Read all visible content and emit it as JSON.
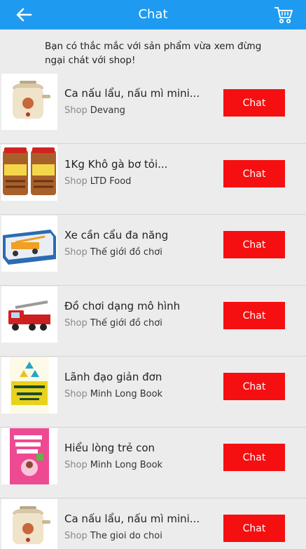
{
  "header": {
    "title": "Chat",
    "back_icon": "arrow-left-icon",
    "cart_icon": "shopping-cart-icon",
    "bg_color": "#1e9bf0"
  },
  "notice": "Bạn có thắc mắc với sản phẩm vừa xem đừng ngại chát với shop!",
  "shop_label": "Shop",
  "chat_label": "Chat",
  "chat_color": "#f50f10",
  "items": [
    {
      "name": "Ca nấu lẩu, nấu mì mini...",
      "shop": "Devang",
      "image": "mini-electric-pot"
    },
    {
      "name": "1Kg Khô gà bơ tỏi...",
      "shop": "LTD Food",
      "image": "dried-chicken-jars"
    },
    {
      "name": "Xe cần cẩu đa năng",
      "shop": "Thế giới đồ chơi",
      "image": "crane-truck-toy-box"
    },
    {
      "name": "Đồ chơi dạng mô hình",
      "shop": "Thế giới đồ chơi",
      "image": "fire-truck-model"
    },
    {
      "name": "Lãnh đạo giản đơn",
      "shop": "Minh Long Book",
      "image": "book-cover-leadership"
    },
    {
      "name": "Hiểu lòng trẻ con",
      "shop": "Minh Long Book",
      "image": "book-cover-children"
    },
    {
      "name": "Ca nấu lẩu, nấu mì mini...",
      "shop": "The gioi do choi",
      "image": "mini-electric-pot"
    }
  ]
}
